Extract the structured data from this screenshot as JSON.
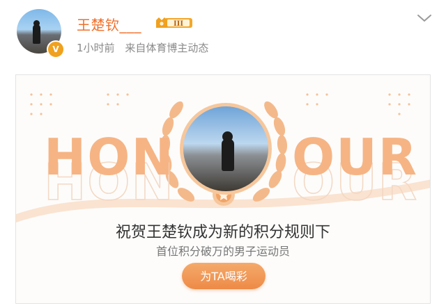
{
  "post": {
    "username": "王楚钦___",
    "vip_level": "III",
    "time": "1小时前",
    "source": "来自体育博主动态"
  },
  "card": {
    "honour_left": "HON",
    "honour_right": "OUR",
    "headline": "祝贺王楚钦成为新的积分规则下",
    "subline": "首位积分破万的男子运动员",
    "button_label": "为TA喝彩"
  },
  "colors": {
    "username": "#f06f2a",
    "accent": "#ee8a47",
    "honour": "#f6b484",
    "meta": "#8a8a8a"
  },
  "icons": [
    "avatar",
    "verified-v-icon",
    "crown-vip-icon",
    "chevron-down-icon",
    "laurel-wreath-icon",
    "medal-icon"
  ]
}
